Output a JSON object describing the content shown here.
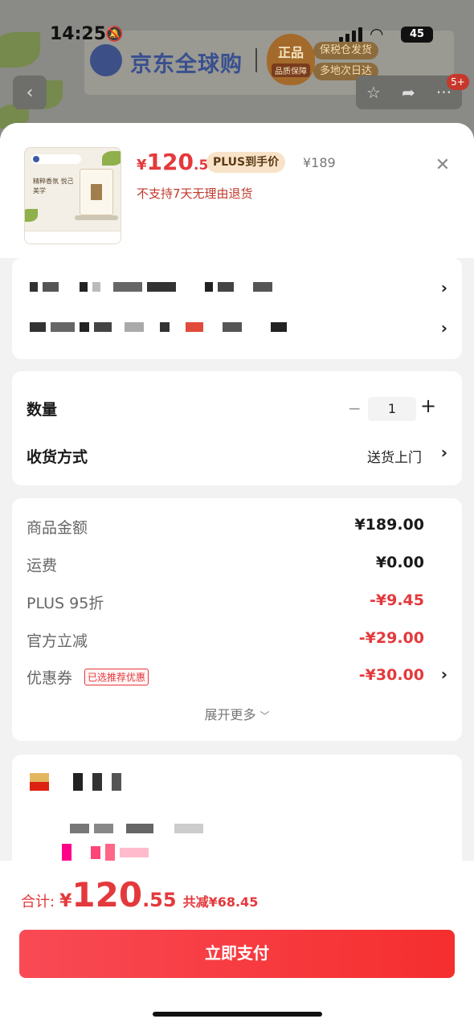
{
  "status_bar": {
    "time": "14:25",
    "battery": "45"
  },
  "background": {
    "logo_text": "京东全球购",
    "seal_text": "正品",
    "seal_sub": "品质保障",
    "tags": [
      "保税仓发货",
      "多地次日达"
    ],
    "badge": "5+"
  },
  "product": {
    "price_symbol": "¥",
    "price_int": "120",
    "price_dec": ".55",
    "plus_tag": "PLUS到手价",
    "original_price": "¥189",
    "return_policy": "不支持7天无理由退货",
    "thumb_text": "精粹香氛 悦己美学"
  },
  "quantity": {
    "label": "数量",
    "value": "1",
    "minus": "−",
    "plus": "+"
  },
  "shipping": {
    "label": "收货方式",
    "value": "送货上门"
  },
  "price_detail": {
    "rows": [
      {
        "label": "商品金额",
        "value": "¥189.00",
        "type": "normal"
      },
      {
        "label": "运费",
        "value": "¥0.00",
        "type": "normal"
      },
      {
        "label": "PLUS 95折",
        "value": "-¥9.45",
        "type": "red"
      },
      {
        "label": "官方立减",
        "value": "-¥29.00",
        "type": "red"
      },
      {
        "label": "优惠券",
        "value": "-¥30.00",
        "type": "red"
      }
    ],
    "coupon_badge": "已选推荐优惠",
    "expand_more": "展开更多"
  },
  "footer": {
    "total_label": "合计:",
    "total_symbol": "¥",
    "total_int": "120",
    "total_dec": ".55",
    "total_discount": "共减¥68.45",
    "pay_button": "立即支付"
  },
  "colors": {
    "accent_red": "#e4393c",
    "plus_gold": "#f8e3c8"
  }
}
